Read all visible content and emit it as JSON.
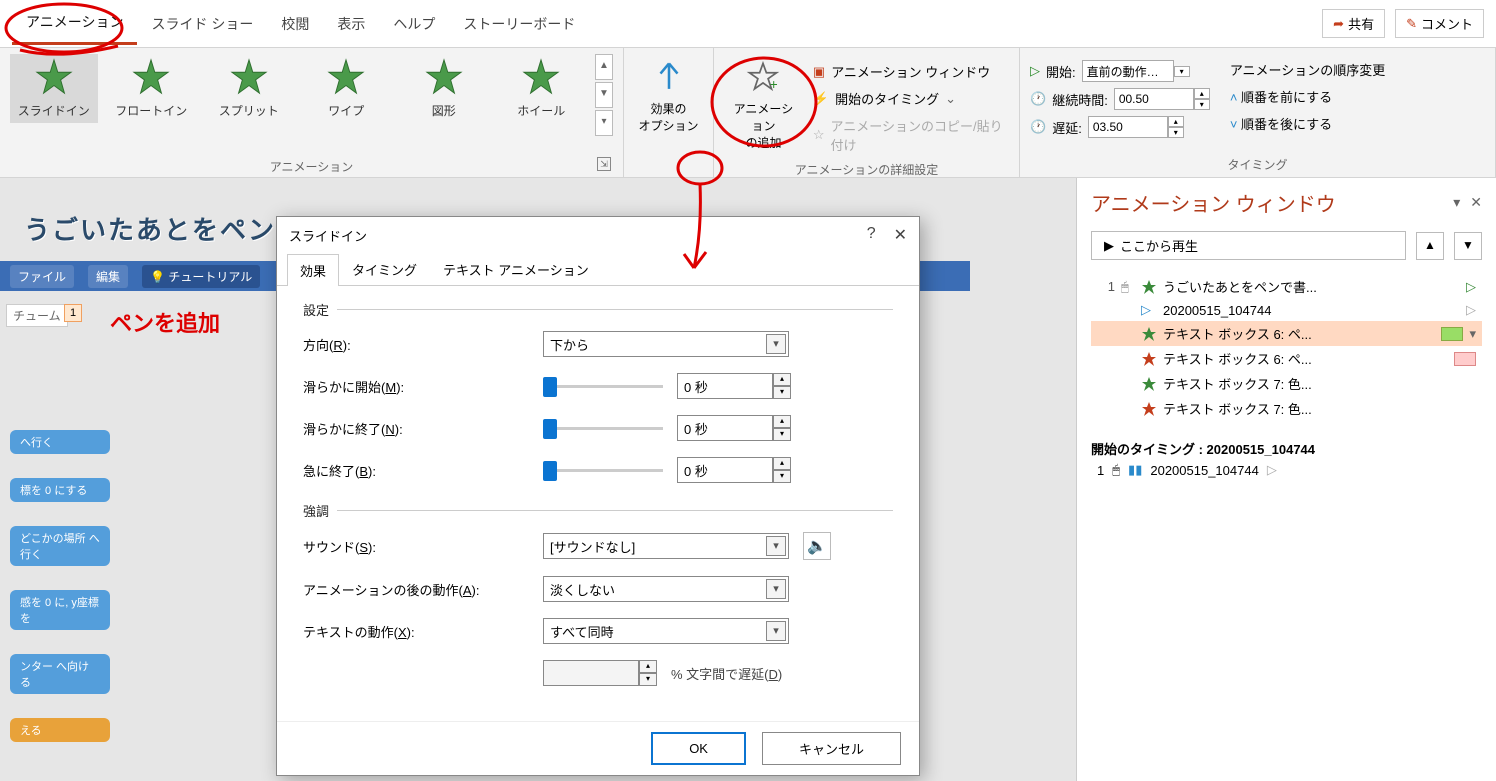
{
  "tabs": {
    "items": [
      "アニメーション",
      "スライド ショー",
      "校閲",
      "表示",
      "ヘルプ",
      "ストーリーボード"
    ],
    "active_index": 0,
    "share": "共有",
    "comment": "コメント"
  },
  "ribbon": {
    "anim_group_label": "アニメーション",
    "effects": [
      "スライドイン",
      "フロートイン",
      "スプリット",
      "ワイプ",
      "図形",
      "ホイール"
    ],
    "selected_effect_index": 0,
    "effect_options": "効果の\nオプション",
    "add_anim": "アニメーション\nの追加",
    "adv_group_label": "アニメーションの詳細設定",
    "anim_window": "アニメーション ウィンドウ",
    "start_timing": "開始のタイミング",
    "copy_paste": "アニメーションのコピー/貼り付け",
    "timing_group_label": "タイミング",
    "start_label": "開始:",
    "start_value": "直前の動作…",
    "duration_label": "継続時間:",
    "duration_value": "00.50",
    "delay_label": "遅延:",
    "delay_value": "03.50",
    "reorder_title": "アニメーションの順序変更",
    "reorder_up": "順番を前にする",
    "reorder_down": "順番を後にする"
  },
  "slide": {
    "title_text": "うごいたあとをペン",
    "toolbar_items": [
      "ファイル",
      "編集",
      "チュートリアル"
    ],
    "tab_name": "チューム",
    "thumb_num": "1",
    "red_note": "ペンを追加",
    "blocks": [
      "へ行く",
      "標を 0 にする",
      "どこかの場所 へ行く",
      "感を 0 に, y座標を",
      "ンター へ向ける",
      "える"
    ]
  },
  "anim_pane": {
    "title": "アニメーション ウィンドウ",
    "play": "ここから再生",
    "items": [
      {
        "num": "1",
        "mouse": true,
        "type": "green",
        "text": "うごいたあとをペンで書...",
        "tri": "green"
      },
      {
        "num": "",
        "mouse": false,
        "type": "blue-tri",
        "text": "20200515_104744",
        "tri": "gray"
      },
      {
        "num": "",
        "mouse": false,
        "type": "green",
        "text": "テキスト ボックス 6: ペ...",
        "bar": "green",
        "sel": true
      },
      {
        "num": "",
        "mouse": false,
        "type": "red",
        "text": "テキスト ボックス 6: ペ...",
        "bar": "pink"
      },
      {
        "num": "",
        "mouse": false,
        "type": "green",
        "text": "テキスト ボックス 7: 色..."
      },
      {
        "num": "",
        "mouse": false,
        "type": "red",
        "text": "テキスト ボックス 7: 色..."
      }
    ],
    "sub_title": "開始のタイミング : 20200515_104744",
    "sub_item": {
      "num": "1",
      "text": "20200515_104744"
    }
  },
  "dialog": {
    "title": "スライドイン",
    "tabs": [
      "効果",
      "タイミング",
      "テキスト アニメーション"
    ],
    "active_tab": 0,
    "settings_label": "設定",
    "direction_label": "方向(R):",
    "direction_value": "下から",
    "smooth_start_label": "滑らかに開始(M):",
    "smooth_end_label": "滑らかに終了(N):",
    "bounce_end_label": "急に終了(B):",
    "sec_zero": "0 秒",
    "emphasis_label": "強調",
    "sound_label": "サウンド(S):",
    "sound_value": "[サウンドなし]",
    "after_label": "アニメーションの後の動作(A):",
    "after_value": "淡くしない",
    "text_label": "テキストの動作(X):",
    "text_value": "すべて同時",
    "delay_letters": "% 文字間で遅延(D)",
    "ok": "OK",
    "cancel": "キャンセル"
  }
}
